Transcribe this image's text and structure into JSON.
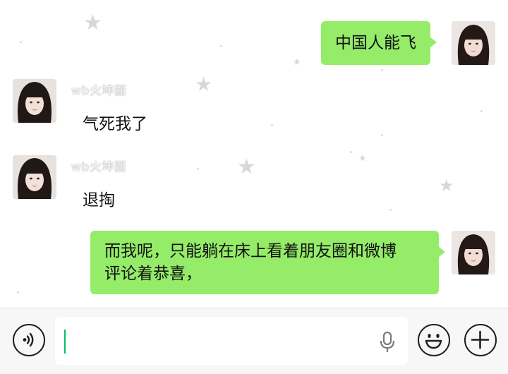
{
  "messages": [
    {
      "direction": "outgoing",
      "text": "中国人能飞"
    },
    {
      "direction": "incoming",
      "sender": "wb火坤面",
      "text": "气死我了"
    },
    {
      "direction": "incoming",
      "sender": "wb火坤面",
      "text": "退掏"
    },
    {
      "direction": "outgoing",
      "lines": [
        "而我呢，只能躺在床上看着朋友圈和微博",
        "评论着恭喜，"
      ]
    }
  ],
  "input_bar": {
    "voice_icon": "voice-icon",
    "text_value": "",
    "mic_icon": "microphone-icon",
    "emoji_icon": "emoji-icon",
    "plus_icon": "plus-icon"
  },
  "colors": {
    "bubble_outgoing": "#95ec69",
    "caret": "#07c160",
    "input_bar_bg": "#f7f7f7"
  }
}
